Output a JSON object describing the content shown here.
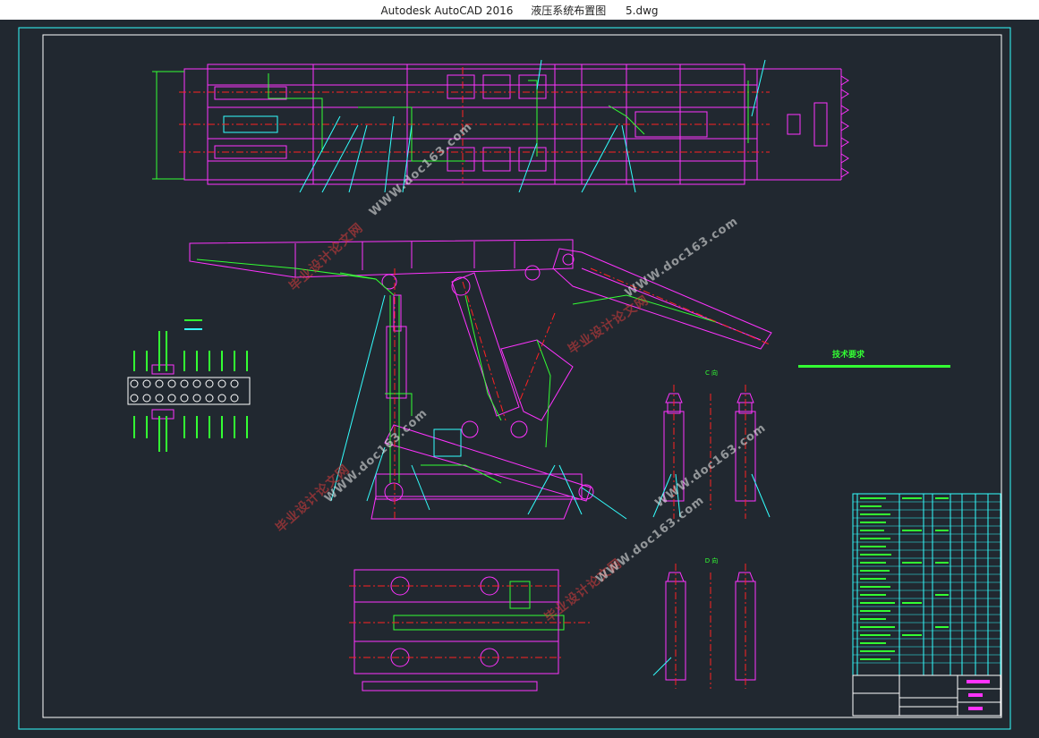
{
  "window": {
    "app_name": "Autodesk AutoCAD 2016",
    "doc_title": "液压系统布置图",
    "file_name": "5.dwg"
  },
  "drawing": {
    "notes_title": "技术要求",
    "view_c": "C 向",
    "view_d": "D 向",
    "colors": {
      "background": "#212830",
      "frame": "#ffffff",
      "magenta": "#ff33ff",
      "green": "#33ff33",
      "red": "#ff2222",
      "cyan": "#33ffff",
      "white": "#ffffff"
    }
  },
  "watermarks": {
    "text_en": "WWW.doc163.com",
    "text_cn": "毕业设计论文网"
  }
}
